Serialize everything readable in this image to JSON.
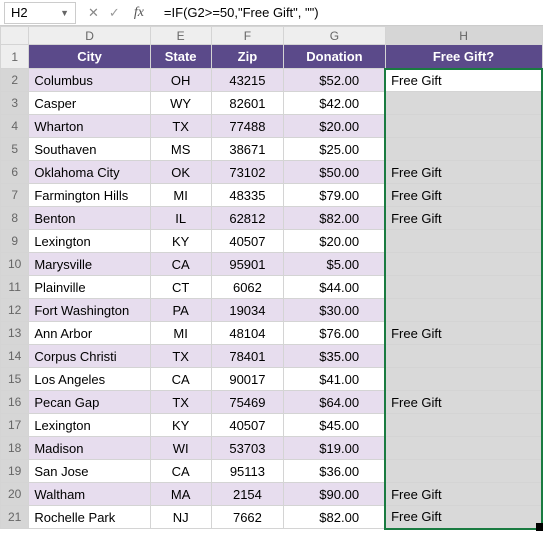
{
  "nameBox": {
    "value": "H2"
  },
  "formulaBar": {
    "formula": "=IF(G2>=50,\"Free Gift\", \"\")"
  },
  "icons": {
    "cancel": "✕",
    "enter": "✓",
    "fx": "fx",
    "dropdown": "▼"
  },
  "columnLetters": [
    "D",
    "E",
    "F",
    "G",
    "H"
  ],
  "headers": {
    "city": "City",
    "state": "State",
    "zip": "Zip",
    "donation": "Donation",
    "gift": "Free Gift?"
  },
  "rows": [
    {
      "n": 2,
      "city": "Columbus",
      "state": "OH",
      "zip": "43215",
      "donation": "$52.00",
      "gift": "Free Gift",
      "odd": false,
      "active": true
    },
    {
      "n": 3,
      "city": "Casper",
      "state": "WY",
      "zip": "82601",
      "donation": "$42.00",
      "gift": "",
      "odd": true
    },
    {
      "n": 4,
      "city": "Wharton",
      "state": "TX",
      "zip": "77488",
      "donation": "$20.00",
      "gift": "",
      "odd": false
    },
    {
      "n": 5,
      "city": "Southaven",
      "state": "MS",
      "zip": "38671",
      "donation": "$25.00",
      "gift": "",
      "odd": true
    },
    {
      "n": 6,
      "city": "Oklahoma City",
      "state": "OK",
      "zip": "73102",
      "donation": "$50.00",
      "gift": "Free Gift",
      "odd": false
    },
    {
      "n": 7,
      "city": "Farmington Hills",
      "state": "MI",
      "zip": "48335",
      "donation": "$79.00",
      "gift": "Free Gift",
      "odd": true
    },
    {
      "n": 8,
      "city": "Benton",
      "state": "IL",
      "zip": "62812",
      "donation": "$82.00",
      "gift": "Free Gift",
      "odd": false
    },
    {
      "n": 9,
      "city": "Lexington",
      "state": "KY",
      "zip": "40507",
      "donation": "$20.00",
      "gift": "",
      "odd": true
    },
    {
      "n": 10,
      "city": "Marysville",
      "state": "CA",
      "zip": "95901",
      "donation": "$5.00",
      "gift": "",
      "odd": false
    },
    {
      "n": 11,
      "city": "Plainville",
      "state": "CT",
      "zip": "6062",
      "donation": "$44.00",
      "gift": "",
      "odd": true
    },
    {
      "n": 12,
      "city": "Fort Washington",
      "state": "PA",
      "zip": "19034",
      "donation": "$30.00",
      "gift": "",
      "odd": false
    },
    {
      "n": 13,
      "city": "Ann Arbor",
      "state": "MI",
      "zip": "48104",
      "donation": "$76.00",
      "gift": "Free Gift",
      "odd": true
    },
    {
      "n": 14,
      "city": "Corpus Christi",
      "state": "TX",
      "zip": "78401",
      "donation": "$35.00",
      "gift": "",
      "odd": false
    },
    {
      "n": 15,
      "city": "Los Angeles",
      "state": "CA",
      "zip": "90017",
      "donation": "$41.00",
      "gift": "",
      "odd": true
    },
    {
      "n": 16,
      "city": "Pecan Gap",
      "state": "TX",
      "zip": "75469",
      "donation": "$64.00",
      "gift": "Free Gift",
      "odd": false
    },
    {
      "n": 17,
      "city": "Lexington",
      "state": "KY",
      "zip": "40507",
      "donation": "$45.00",
      "gift": "",
      "odd": true
    },
    {
      "n": 18,
      "city": "Madison",
      "state": "WI",
      "zip": "53703",
      "donation": "$19.00",
      "gift": "",
      "odd": false
    },
    {
      "n": 19,
      "city": "San Jose",
      "state": "CA",
      "zip": "95113",
      "donation": "$36.00",
      "gift": "",
      "odd": true
    },
    {
      "n": 20,
      "city": "Waltham",
      "state": "MA",
      "zip": "2154",
      "donation": "$90.00",
      "gift": "Free Gift",
      "odd": false
    },
    {
      "n": 21,
      "city": "Rochelle Park",
      "state": "NJ",
      "zip": "7662",
      "donation": "$82.00",
      "gift": "Free Gift",
      "odd": true
    }
  ]
}
